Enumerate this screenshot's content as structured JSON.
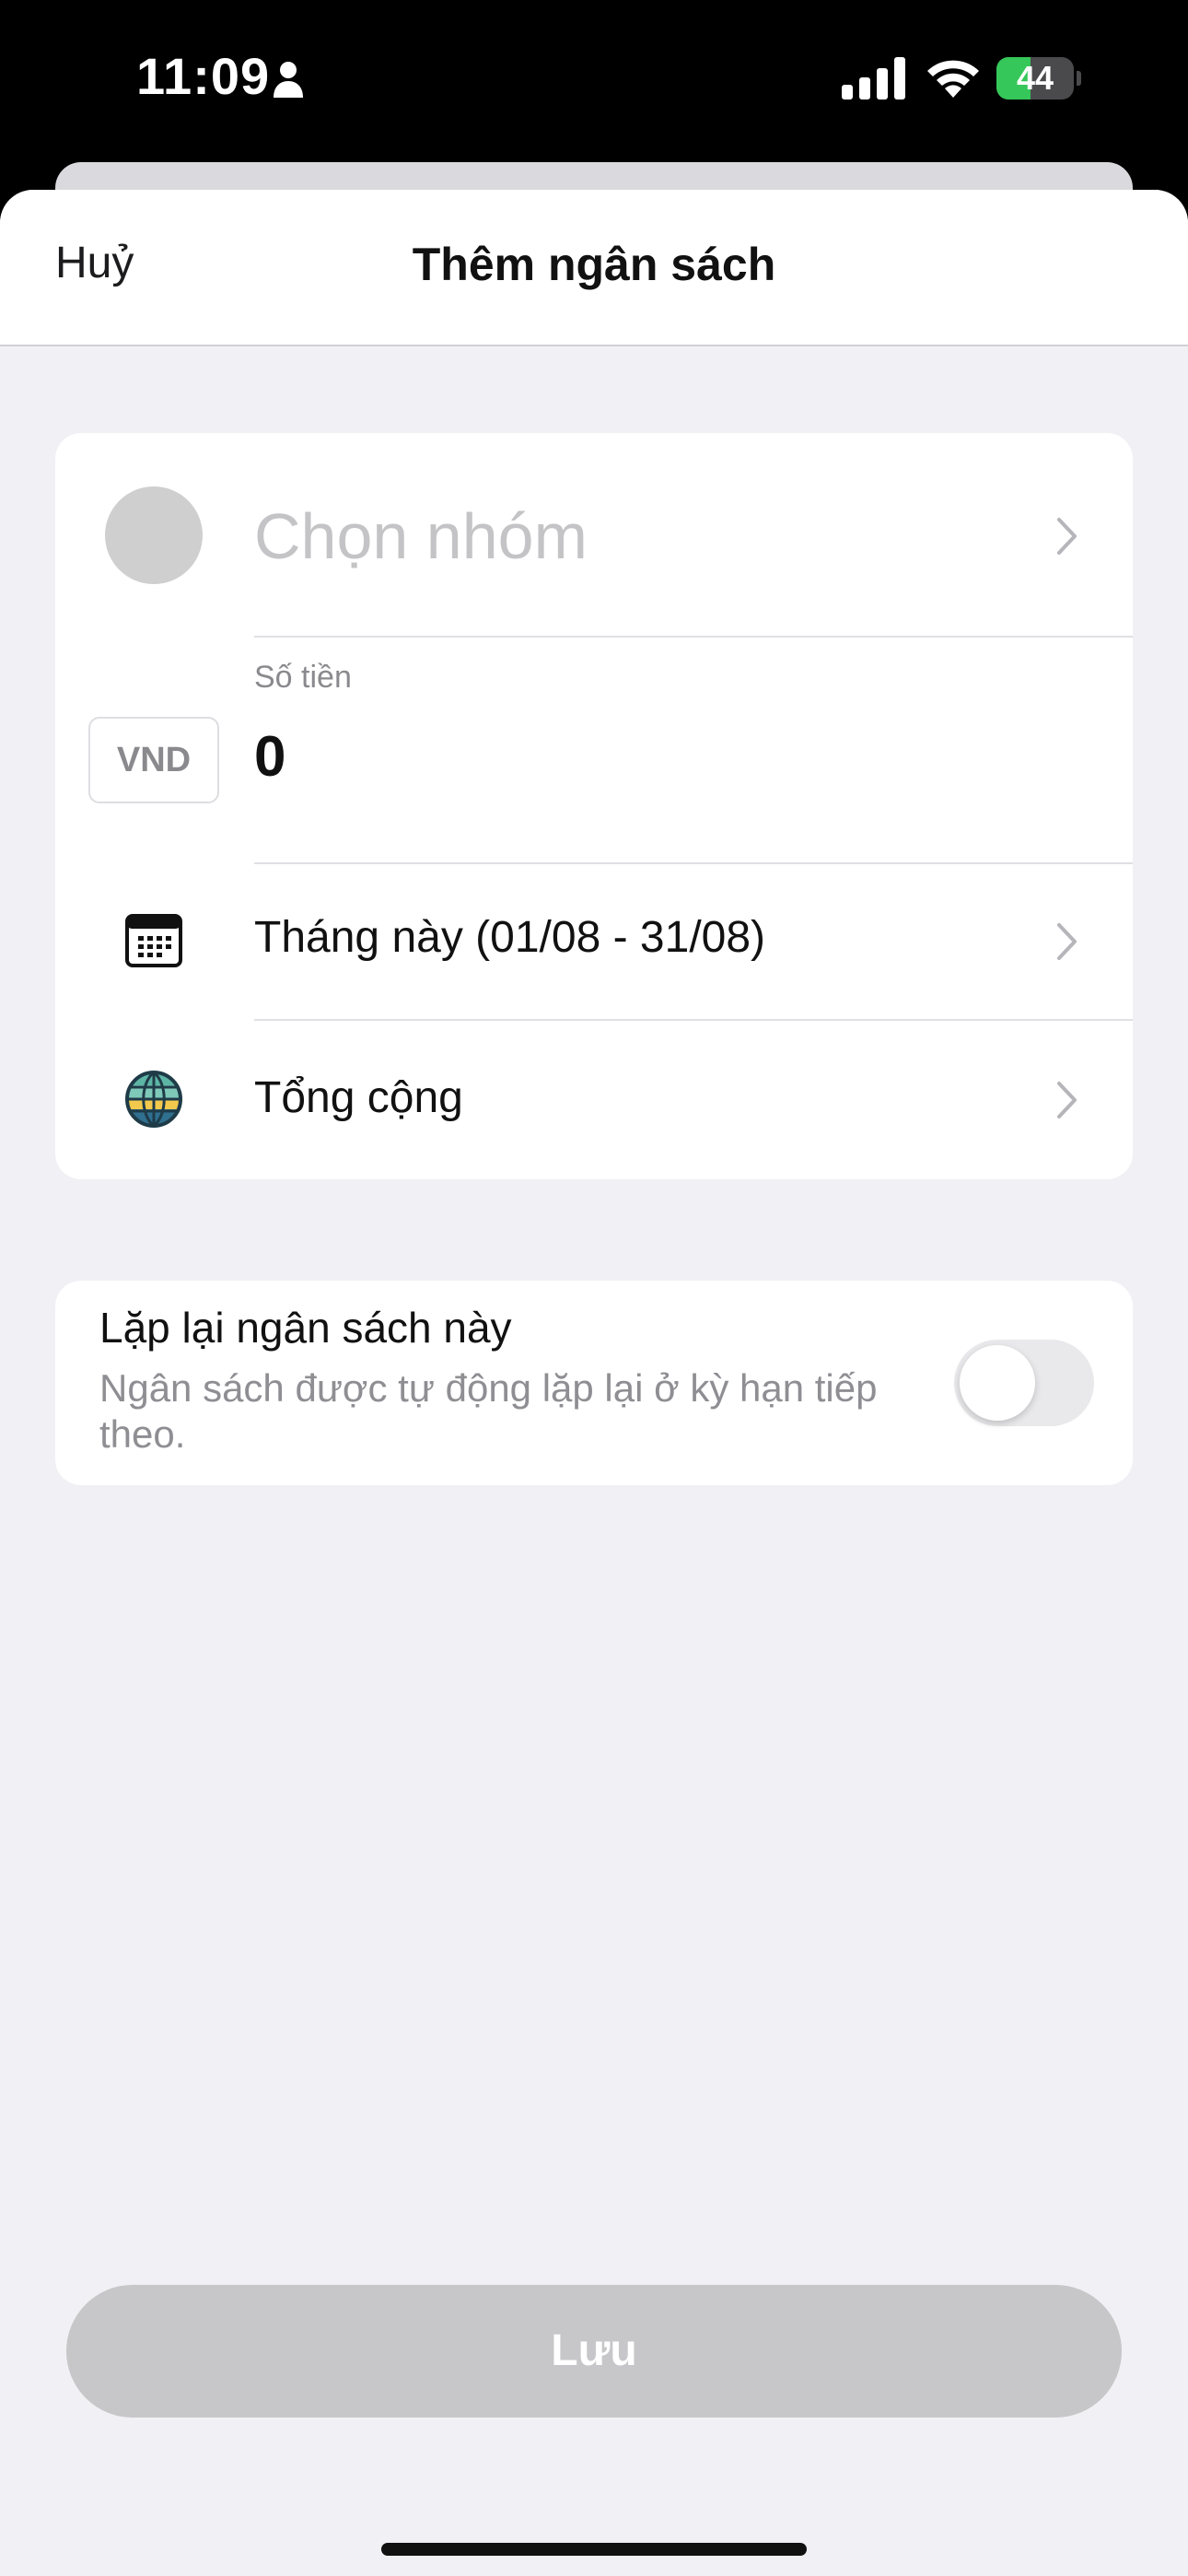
{
  "status_bar": {
    "time": "11:09",
    "battery": "44",
    "battery_level": 0.44,
    "battery_fill_color": "#35c759"
  },
  "nav": {
    "cancel": "Huỷ",
    "title": "Thêm ngân sách"
  },
  "budget_form": {
    "category_placeholder": "Chọn nhóm",
    "amount_label": "Số tiền",
    "currency": "VND",
    "amount_value": "0",
    "period": "Tháng này (01/08 - 31/08)",
    "wallet": "Tổng cộng",
    "icons": {
      "category": "category-placeholder-icon",
      "period": "calendar-icon",
      "wallet": "globe-wallet-icon",
      "chevron": "chevron-right-icon"
    }
  },
  "repeat": {
    "title": "Lặp lại ngân sách này",
    "description": "Ngân sách được tự động lặp lại ở kỳ hạn tiếp theo.",
    "enabled": false
  },
  "save_button": {
    "label": "Lưu",
    "enabled": false,
    "color": "#c7c7c9"
  }
}
